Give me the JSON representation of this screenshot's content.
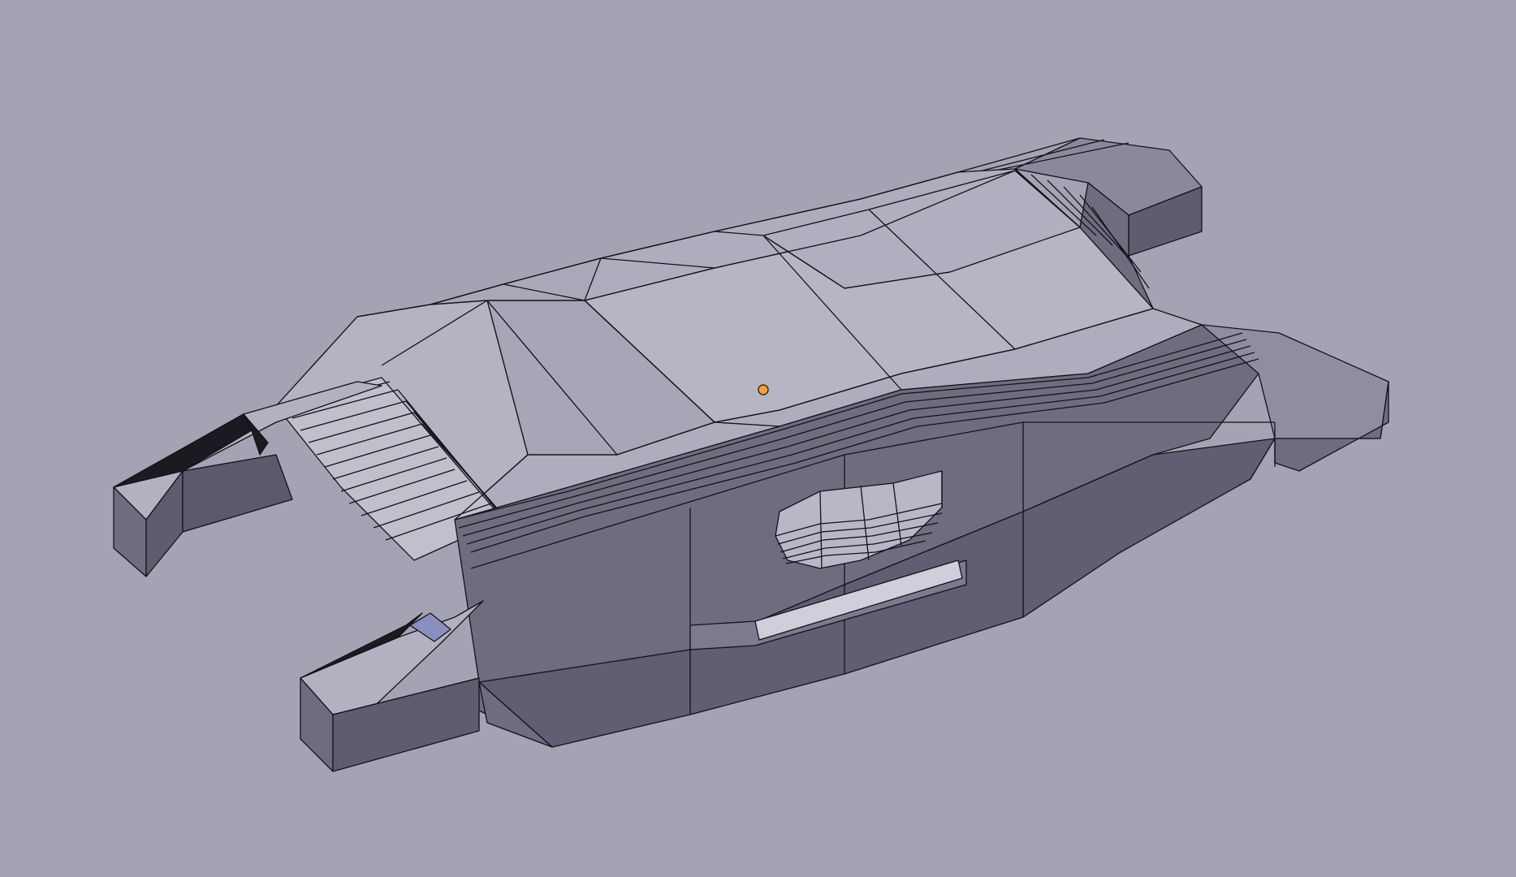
{
  "viewport": {
    "background_color": "#a4a3b3",
    "view": "3D viewport"
  },
  "model": {
    "object_type": "mesh",
    "shading": "solid",
    "colors": {
      "top_face": "#aeadbd",
      "top_face_light": "#b6b5c4",
      "side_face_light": "#8f8ea0",
      "side_face_mid": "#6e6d80",
      "side_face_dark": "#5b5a6c",
      "shadow": "#1a1a20",
      "edge": "#121218"
    }
  },
  "origin_marker": {
    "color": "#f0a040",
    "outline": "#4a3000"
  }
}
